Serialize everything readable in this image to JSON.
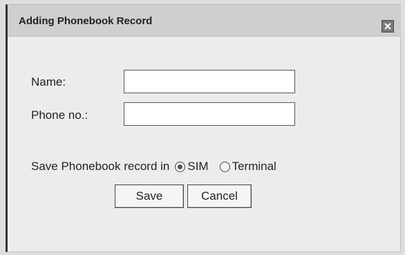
{
  "dialog": {
    "title": "Adding Phonebook Record",
    "close_icon": "close-icon"
  },
  "form": {
    "name_label": "Name:",
    "name_value": "",
    "phone_label": "Phone no.:",
    "phone_value": "",
    "save_in_label": "Save Phonebook record in",
    "options": [
      {
        "label": "SIM",
        "selected": true
      },
      {
        "label": "Terminal",
        "selected": false
      }
    ]
  },
  "buttons": {
    "save": "Save",
    "cancel": "Cancel"
  }
}
